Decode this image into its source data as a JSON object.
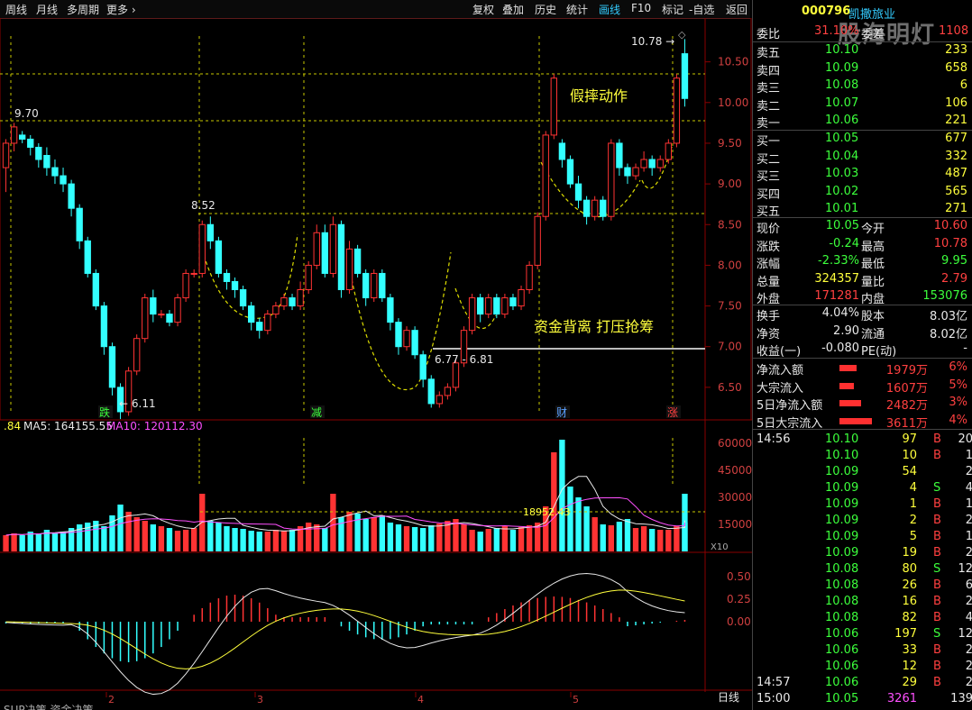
{
  "toolbar": {
    "left": [
      "周线",
      "月线",
      "多周期",
      "更多"
    ],
    "right": [
      "复权",
      "叠加",
      "历史",
      "统计",
      "画线",
      "F10",
      "标记",
      "-自选",
      "返回"
    ]
  },
  "stock": {
    "code": "000796",
    "name": "凯撒旅业",
    "watermark": "股海明灯"
  },
  "weibi": {
    "label": "委比",
    "pct": "31.10%",
    "diff_label": "委差",
    "diff": "1108"
  },
  "sell": [
    {
      "label": "卖五",
      "price": "10.10",
      "vol": "233"
    },
    {
      "label": "卖四",
      "price": "10.09",
      "vol": "658"
    },
    {
      "label": "卖三",
      "price": "10.08",
      "vol": "6"
    },
    {
      "label": "卖二",
      "price": "10.07",
      "vol": "106"
    },
    {
      "label": "卖一",
      "price": "10.06",
      "vol": "221"
    }
  ],
  "buy": [
    {
      "label": "买一",
      "price": "10.05",
      "vol": "677"
    },
    {
      "label": "买二",
      "price": "10.04",
      "vol": "332"
    },
    {
      "label": "买三",
      "price": "10.03",
      "vol": "487"
    },
    {
      "label": "买四",
      "price": "10.02",
      "vol": "565"
    },
    {
      "label": "买五",
      "price": "10.01",
      "vol": "271"
    }
  ],
  "quote": [
    {
      "l1": "现价",
      "v1": "10.05",
      "l2": "今开",
      "v2": "10.60"
    },
    {
      "l1": "涨跌",
      "v1": "-0.24",
      "l2": "最高",
      "v2": "10.78"
    },
    {
      "l1": "涨幅",
      "v1": "-2.33%",
      "l2": "最低",
      "v2": "9.95"
    },
    {
      "l1": "总量",
      "v1": "324357",
      "l2": "量比",
      "v2": "2.79"
    },
    {
      "l1": "外盘",
      "v1": "171281",
      "l2": "内盘",
      "v2": "153076"
    }
  ],
  "quote2": [
    {
      "l1": "换手",
      "v1": "4.04%",
      "l2": "股本",
      "v2": "8.03亿"
    },
    {
      "l1": "净资",
      "v1": "2.90",
      "l2": "流通",
      "v2": "8.02亿"
    },
    {
      "l1": "收益(一)",
      "v1": "-0.080",
      "l2": "PE(动)",
      "v2": "-"
    }
  ],
  "flows": [
    {
      "label": "净流入额",
      "amount": "1979万",
      "pct": "6%",
      "bar": 0.4
    },
    {
      "label": "大宗流入",
      "amount": "1607万",
      "pct": "5%",
      "bar": 0.33
    },
    {
      "label": "5日净流入额",
      "amount": "2482万",
      "pct": "3%",
      "bar": 0.5
    },
    {
      "label": "5日大宗流入",
      "amount": "3611万",
      "pct": "4%",
      "bar": 0.75
    }
  ],
  "ticks": [
    {
      "time": "14:56",
      "price": "10.10",
      "vol": "97",
      "bs": "B",
      "n": "20"
    },
    {
      "time": "",
      "price": "10.10",
      "vol": "10",
      "bs": "B",
      "n": "1"
    },
    {
      "time": "",
      "price": "10.09",
      "vol": "54",
      "bs": "",
      "n": "2"
    },
    {
      "time": "",
      "price": "10.09",
      "vol": "4",
      "bs": "S",
      "n": "4"
    },
    {
      "time": "",
      "price": "10.09",
      "vol": "1",
      "bs": "B",
      "n": "1"
    },
    {
      "time": "",
      "price": "10.09",
      "vol": "2",
      "bs": "B",
      "n": "2"
    },
    {
      "time": "",
      "price": "10.09",
      "vol": "5",
      "bs": "B",
      "n": "1"
    },
    {
      "time": "",
      "price": "10.09",
      "vol": "19",
      "bs": "B",
      "n": "2"
    },
    {
      "time": "",
      "price": "10.08",
      "vol": "80",
      "bs": "S",
      "n": "12"
    },
    {
      "time": "",
      "price": "10.08",
      "vol": "26",
      "bs": "B",
      "n": "6"
    },
    {
      "time": "",
      "price": "10.08",
      "vol": "16",
      "bs": "B",
      "n": "2"
    },
    {
      "time": "",
      "price": "10.08",
      "vol": "82",
      "bs": "B",
      "n": "4"
    },
    {
      "time": "",
      "price": "10.06",
      "vol": "197",
      "bs": "S",
      "n": "12"
    },
    {
      "time": "",
      "price": "10.06",
      "vol": "33",
      "bs": "B",
      "n": "2"
    },
    {
      "time": "",
      "price": "10.06",
      "vol": "12",
      "bs": "B",
      "n": "2"
    },
    {
      "time": "14:57",
      "price": "10.06",
      "vol": "29",
      "bs": "B",
      "n": "2"
    },
    {
      "time": "15:00",
      "price": "10.05",
      "vol": "3261",
      "bs": "",
      "n": "139"
    }
  ],
  "chart_data": {
    "type": "candlestick",
    "price_axis": [
      "10.50",
      "10.00",
      "9.50",
      "9.00",
      "8.50",
      "8.00",
      "7.50",
      "7.00",
      "6.50"
    ],
    "ylim": [
      6.1,
      10.95
    ],
    "annotations": {
      "high": "10.78",
      "low": "6.11",
      "level_970": "9.70",
      "level_852": "8.52",
      "range": "6.77 - 6.81",
      "text1": "假摔动作",
      "text2": "资金背离  打压抢筹",
      "markers": [
        "跌",
        "减",
        "财",
        "涨"
      ]
    },
    "candles": [
      [
        9.2,
        9.5,
        8.9,
        9.55
      ],
      [
        9.5,
        9.7,
        9.4,
        9.75
      ],
      [
        9.6,
        9.55,
        9.5,
        9.65
      ],
      [
        9.55,
        9.45,
        9.35,
        9.6
      ],
      [
        9.45,
        9.3,
        9.2,
        9.5
      ],
      [
        9.35,
        9.2,
        9.1,
        9.45
      ],
      [
        9.2,
        9.1,
        9.0,
        9.3
      ],
      [
        9.1,
        9.0,
        8.9,
        9.2
      ],
      [
        9.0,
        8.7,
        8.6,
        9.05
      ],
      [
        8.7,
        8.3,
        8.2,
        8.75
      ],
      [
        8.3,
        7.9,
        7.85,
        8.35
      ],
      [
        7.9,
        7.5,
        7.45,
        7.95
      ],
      [
        7.5,
        7.0,
        6.9,
        7.55
      ],
      [
        7.0,
        6.5,
        6.4,
        7.05
      ],
      [
        6.5,
        6.2,
        6.11,
        6.55
      ],
      [
        6.2,
        6.7,
        6.15,
        6.75
      ],
      [
        6.7,
        7.1,
        6.65,
        7.15
      ],
      [
        7.1,
        7.6,
        7.05,
        7.65
      ],
      [
        7.6,
        7.4,
        7.3,
        7.7
      ],
      [
        7.4,
        7.4,
        7.35,
        7.45
      ],
      [
        7.4,
        7.3,
        7.25,
        7.45
      ],
      [
        7.3,
        7.6,
        7.25,
        7.65
      ],
      [
        7.6,
        7.9,
        7.55,
        7.95
      ],
      [
        7.9,
        7.9,
        7.85,
        7.95
      ],
      [
        7.9,
        8.5,
        7.85,
        8.55
      ],
      [
        8.5,
        8.3,
        8.2,
        8.6
      ],
      [
        8.3,
        7.9,
        7.85,
        8.35
      ],
      [
        7.9,
        7.8,
        7.7,
        7.95
      ],
      [
        7.8,
        7.7,
        7.6,
        7.85
      ],
      [
        7.7,
        7.5,
        7.45,
        7.75
      ],
      [
        7.5,
        7.3,
        7.2,
        7.55
      ],
      [
        7.3,
        7.2,
        7.1,
        7.35
      ],
      [
        7.2,
        7.4,
        7.15,
        7.45
      ],
      [
        7.4,
        7.5,
        7.35,
        7.55
      ],
      [
        7.5,
        7.6,
        7.45,
        7.65
      ],
      [
        7.6,
        7.5,
        7.45,
        7.65
      ],
      [
        7.5,
        7.7,
        7.45,
        7.8
      ],
      [
        7.7,
        8.0,
        7.65,
        8.05
      ],
      [
        8.0,
        8.4,
        7.95,
        8.5
      ],
      [
        8.4,
        7.9,
        7.85,
        8.5
      ],
      [
        7.9,
        8.5,
        7.85,
        8.6
      ],
      [
        8.5,
        7.7,
        7.6,
        8.55
      ],
      [
        7.7,
        8.2,
        7.65,
        8.3
      ],
      [
        8.2,
        7.9,
        7.85,
        8.25
      ],
      [
        7.9,
        7.6,
        7.5,
        7.95
      ],
      [
        7.6,
        7.9,
        7.55,
        7.95
      ],
      [
        7.9,
        7.6,
        7.55,
        7.95
      ],
      [
        7.6,
        7.3,
        7.2,
        7.65
      ],
      [
        7.3,
        7.0,
        6.9,
        7.35
      ],
      [
        7.0,
        7.2,
        6.95,
        7.25
      ],
      [
        7.2,
        6.9,
        6.85,
        7.25
      ],
      [
        6.9,
        6.6,
        6.5,
        6.95
      ],
      [
        6.6,
        6.3,
        6.25,
        6.65
      ],
      [
        6.3,
        6.4,
        6.25,
        6.45
      ],
      [
        6.4,
        6.5,
        6.35,
        6.55
      ],
      [
        6.5,
        6.8,
        6.45,
        6.85
      ],
      [
        6.8,
        7.2,
        6.75,
        7.25
      ],
      [
        7.2,
        7.6,
        7.15,
        7.65
      ],
      [
        7.6,
        7.4,
        7.3,
        7.65
      ],
      [
        7.4,
        7.6,
        7.35,
        7.65
      ],
      [
        7.6,
        7.4,
        7.35,
        7.65
      ],
      [
        7.4,
        7.6,
        7.35,
        7.65
      ],
      [
        7.6,
        7.5,
        7.45,
        7.65
      ],
      [
        7.5,
        7.7,
        7.45,
        7.75
      ],
      [
        7.7,
        8.0,
        7.65,
        8.05
      ],
      [
        8.0,
        8.6,
        7.95,
        8.65
      ],
      [
        8.6,
        9.6,
        8.55,
        9.65
      ],
      [
        9.6,
        10.3,
        9.55,
        10.35
      ],
      [
        9.5,
        9.3,
        9.2,
        9.55
      ],
      [
        9.3,
        9.0,
        8.95,
        9.35
      ],
      [
        9.0,
        8.8,
        8.7,
        9.1
      ],
      [
        8.8,
        8.6,
        8.5,
        8.85
      ],
      [
        8.6,
        8.8,
        8.55,
        8.85
      ],
      [
        8.8,
        8.6,
        8.55,
        8.85
      ],
      [
        8.6,
        9.5,
        8.55,
        9.55
      ],
      [
        9.5,
        9.2,
        9.1,
        9.55
      ],
      [
        9.2,
        9.1,
        9.0,
        9.25
      ],
      [
        9.1,
        9.2,
        9.05,
        9.25
      ],
      [
        9.2,
        9.3,
        9.15,
        9.4
      ],
      [
        9.3,
        9.2,
        9.1,
        9.35
      ],
      [
        9.2,
        9.3,
        9.15,
        9.35
      ],
      [
        9.3,
        9.5,
        9.25,
        9.55
      ],
      [
        9.5,
        10.3,
        9.45,
        10.35
      ],
      [
        10.6,
        10.05,
        9.95,
        10.78
      ]
    ],
    "volume_axis": [
      "60000",
      "45000",
      "30000",
      "15000"
    ],
    "volume_label": "18952.43",
    "ma_label": {
      "ma5": "MA5: 164155.55",
      "ma10": "MA10: 120112.30",
      "prefix": ".84"
    },
    "x10_label": "X10",
    "macd_axis": [
      "0.50",
      "0.25",
      "0.00"
    ],
    "date_labels": [
      "2",
      "3",
      "4",
      "5"
    ],
    "period_label": "日线",
    "bottom_tabs": "SUP决策  资金决策"
  }
}
